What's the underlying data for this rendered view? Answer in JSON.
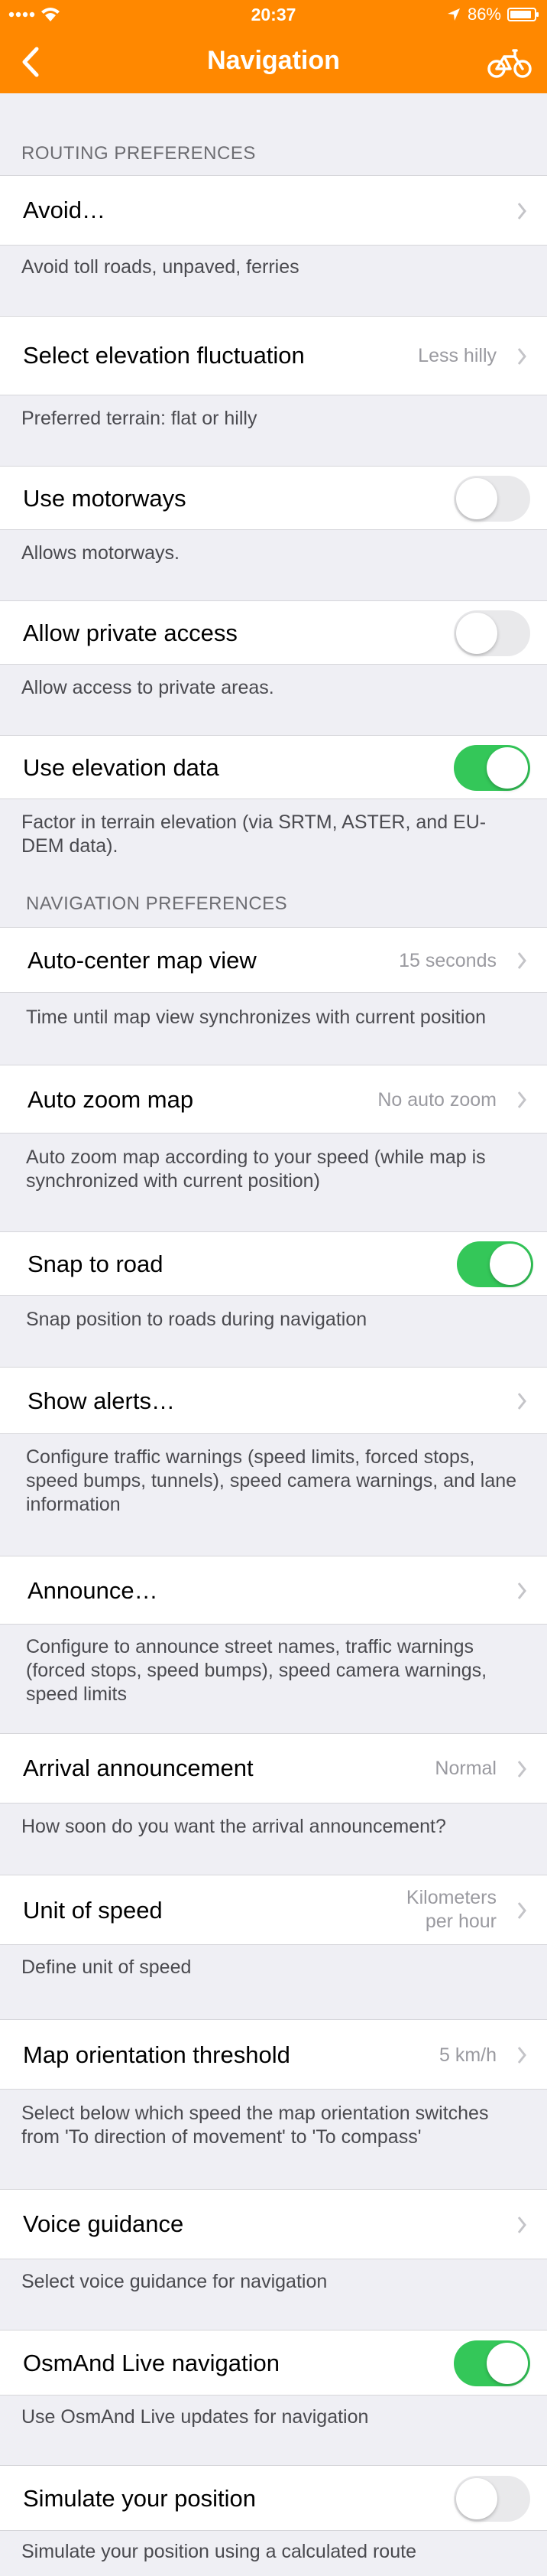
{
  "status_bar": {
    "time": "20:37",
    "battery": "86%"
  },
  "nav": {
    "title": "Navigation",
    "back_icon": "chevron-left-icon",
    "profile_icon": "bicycle-icon"
  },
  "routing_header": "ROUTING PREFERENCES",
  "navigation_header": "NAVIGATION PREFERENCES",
  "items": [
    {
      "label": "Avoid…",
      "desc": "Avoid toll roads, unpaved, ferries"
    },
    {
      "label": "Select elevation fluctuation",
      "value": "Less hilly",
      "desc": "Preferred terrain: flat or hilly"
    },
    {
      "label": "Use motorways",
      "toggle": "off",
      "desc": "Allows motorways."
    },
    {
      "label": "Allow private access",
      "toggle": "off",
      "desc": "Allow access to private areas."
    },
    {
      "label": "Use elevation data",
      "toggle": "on",
      "desc": "Factor in terrain elevation (via SRTM, ASTER, and EU-DEM data)."
    },
    {
      "label": "Auto-center map view",
      "value": "15 seconds",
      "desc": "Time until map view synchronizes with current position"
    },
    {
      "label": "Auto zoom map",
      "value": "No auto zoom",
      "desc": "Auto zoom map according to your speed (while map is synchronized with current position)"
    },
    {
      "label": "Snap to road",
      "toggle": "on",
      "desc": "Snap position to roads during navigation"
    },
    {
      "label": "Show alerts…",
      "desc": "Configure traffic warnings (speed limits, forced stops, speed bumps, tunnels), speed camera warnings, and lane information"
    },
    {
      "label": "Announce…",
      "desc": "Configure to announce street names, traffic warnings (forced stops, speed bumps), speed camera warnings, speed limits"
    },
    {
      "label": "Arrival announcement",
      "value": "Normal",
      "desc": "How soon do you want the arrival announcement?"
    },
    {
      "label": "Unit of speed",
      "value_line1": "Kilometers",
      "value_line2": "per hour",
      "desc": "Define unit of speed"
    },
    {
      "label": "Map orientation threshold",
      "value": "5 km/h",
      "desc": "Select below which speed the map orientation switches from 'To direction of movement' to 'To compass'"
    },
    {
      "label": "Voice guidance",
      "desc": "Select voice guidance for navigation"
    },
    {
      "label": "OsmAnd Live navigation",
      "toggle": "on",
      "desc": "Use OsmAnd Live updates for navigation"
    },
    {
      "label": "Simulate your position",
      "toggle": "off",
      "desc": "Simulate your position using a calculated route"
    }
  ],
  "colors": {
    "accent": "#ff8800",
    "toggle_on": "#34c759",
    "toggle_off": "#e9e9eb",
    "background": "#efeff4"
  }
}
